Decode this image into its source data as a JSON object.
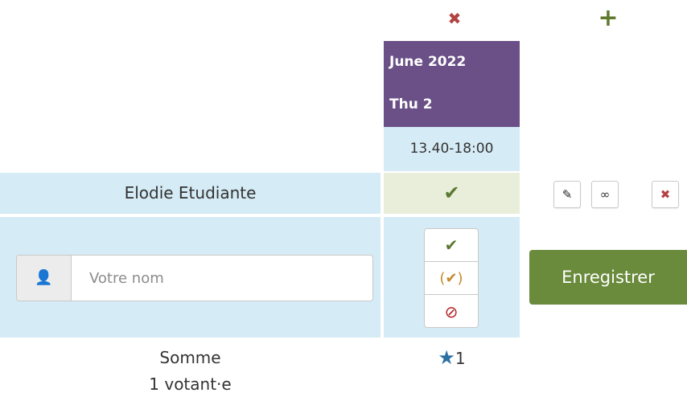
{
  "icons": {
    "column_delete": "✖",
    "column_add": "+",
    "vote_yes": "✔",
    "edit": "✎",
    "link": "∞",
    "remove": "✖",
    "user": "👤",
    "choice_yes": "✔",
    "choice_maybe": "(✔)",
    "choice_no": "⊘",
    "star": "★"
  },
  "date_column": {
    "month": "June 2022",
    "day": "Thu 2",
    "time": "13.40-18:00"
  },
  "participants": [
    {
      "name": "Elodie Etudiante"
    }
  ],
  "new_vote": {
    "name_placeholder": "Votre nom",
    "save_label": "Enregistrer"
  },
  "summary": {
    "label": "Somme",
    "voters": "1 votant·e",
    "score": "1"
  },
  "colors": {
    "header_purple": "#6a5087",
    "light_blue": "#d5ebf5",
    "yes_cell": "#e9eedb",
    "save_green": "#6a8a3c",
    "delete_red": "#b34242"
  }
}
